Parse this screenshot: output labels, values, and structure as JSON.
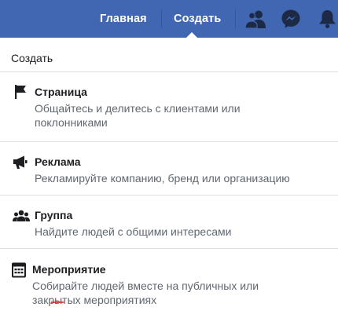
{
  "topbar": {
    "home_label": "Главная",
    "create_label": "Создать",
    "bg_color": "#4267b2",
    "icons": [
      "friends-icon",
      "messenger-icon",
      "bell-icon"
    ]
  },
  "menu": {
    "title": "Создать",
    "items": [
      {
        "icon": "flag-icon",
        "title": "Страница",
        "description": "Общайтесь и делитесь с клиентами или поклонниками"
      },
      {
        "icon": "megaphone-icon",
        "title": "Реклама",
        "description": "Рекламируйте компанию, бренд или организацию"
      },
      {
        "icon": "group-icon",
        "title": "Группа",
        "description": "Найдите людей с общими интересами"
      },
      {
        "icon": "calendar-icon",
        "title": "Мероприятие",
        "description": "Собирайте людей вместе на публичных или закрытых мероприятиях"
      }
    ]
  }
}
